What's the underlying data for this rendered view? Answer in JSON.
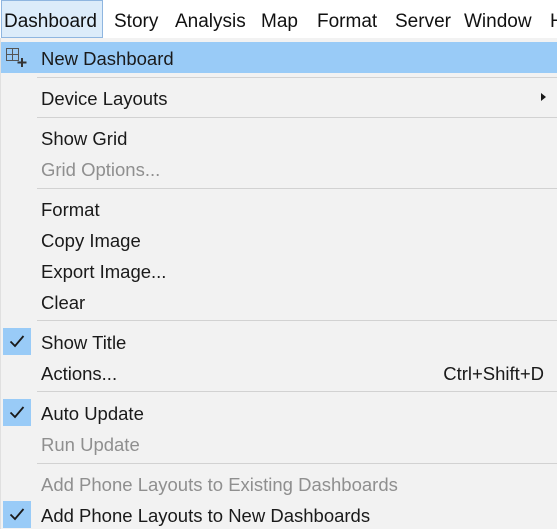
{
  "menubar": {
    "items": [
      "Dashboard",
      "Story",
      "Analysis",
      "Map",
      "Format",
      "Server",
      "Window",
      "H"
    ],
    "active": "Dashboard"
  },
  "menu": {
    "new_dashboard": "New Dashboard",
    "device_layouts": "Device Layouts",
    "show_grid": "Show Grid",
    "grid_options": "Grid Options...",
    "format": "Format",
    "copy_image": "Copy Image",
    "export_image": "Export Image...",
    "clear": "Clear",
    "show_title": "Show Title",
    "actions": "Actions...",
    "actions_shortcut": "Ctrl+Shift+D",
    "auto_update": "Auto Update",
    "run_update": "Run Update",
    "add_phone_existing": "Add Phone Layouts to Existing Dashboards",
    "add_phone_new": "Add Phone Layouts to New Dashboards"
  },
  "checked": {
    "show_title": true,
    "auto_update": true,
    "add_phone_new": true
  },
  "colors": {
    "highlight": "#99cbf7",
    "menu_bg": "#f2f2f2",
    "disabled_text": "#8f8f8f"
  },
  "icons": {
    "new_dashboard": "new-dashboard-icon",
    "check": "checkmark-icon",
    "submenu": "submenu-arrow-icon"
  }
}
